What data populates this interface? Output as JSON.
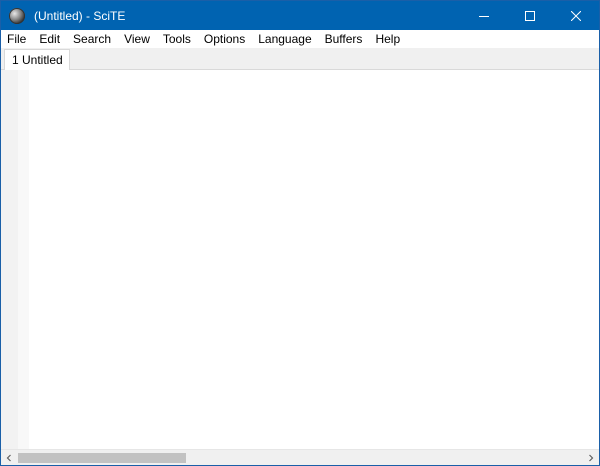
{
  "window": {
    "title": "(Untitled) - SciTE",
    "app_icon": "scite-app-icon",
    "controls": [
      "minimize-icon",
      "maximize-icon",
      "close-icon"
    ]
  },
  "menu": {
    "items": [
      "File",
      "Edit",
      "Search",
      "View",
      "Tools",
      "Options",
      "Language",
      "Buffers",
      "Help"
    ]
  },
  "tabs": [
    {
      "label": "1 Untitled",
      "active": true
    }
  ],
  "editor": {
    "content": ""
  },
  "scrollbar": {
    "horizontal_position": 0.0,
    "left_arrow": "chevron-left-icon",
    "right_arrow": "chevron-right-icon"
  },
  "colors": {
    "titlebar": "#0063b1",
    "title_text": "#ffffff",
    "menubar": "#ffffff",
    "chrome": "#f0f0f0",
    "editor_bg": "#ffffff",
    "scroll_thumb": "#c2c2c2"
  }
}
